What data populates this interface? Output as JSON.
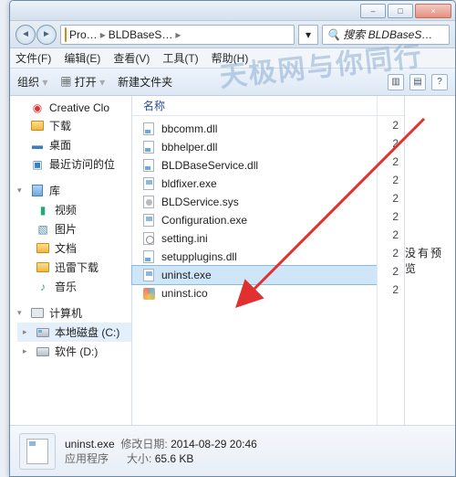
{
  "window": {
    "minimize": "–",
    "maximize": "□",
    "close": "×"
  },
  "address": {
    "back": "◄",
    "fwd": "►",
    "seg1": "Pro…",
    "seg2": "BLDBaseS…",
    "refresh": "↻",
    "search_placeholder": "搜索 BLDBaseS…"
  },
  "menu": {
    "file": "文件(F)",
    "edit": "编辑(E)",
    "view": "查看(V)",
    "tools": "工具(T)",
    "help": "帮助(H)"
  },
  "toolbar": {
    "organize": "组织",
    "open": "打开",
    "newfolder": "新建文件夹",
    "view_ic": "▥",
    "preview_ic": "▤",
    "help_ic": "?"
  },
  "nav": {
    "cc": "Creative Clo",
    "downloads": "下载",
    "desktop": "桌面",
    "recent": "最近访问的位",
    "lib": "库",
    "videos": "视频",
    "pictures": "图片",
    "docs": "文档",
    "xldl": "迅雷下载",
    "music": "音乐",
    "computer": "计算机",
    "drive_c": "本地磁盘 (C:)",
    "drive_d": "软件 (D:)"
  },
  "list": {
    "header_name": "名称",
    "files": [
      {
        "name": "bbcomm.dll",
        "icon": "dll",
        "d": "2"
      },
      {
        "name": "bbhelper.dll",
        "icon": "dll",
        "d": "2"
      },
      {
        "name": "BLDBaseService.dll",
        "icon": "dll",
        "d": "2"
      },
      {
        "name": "bldfixer.exe",
        "icon": "exe",
        "d": "2"
      },
      {
        "name": "BLDService.sys",
        "icon": "sys",
        "d": "2"
      },
      {
        "name": "Configuration.exe",
        "icon": "exe",
        "d": "2"
      },
      {
        "name": "setting.ini",
        "icon": "ini",
        "d": "2"
      },
      {
        "name": "setupplugins.dll",
        "icon": "dll",
        "d": "2"
      },
      {
        "name": "uninst.exe",
        "icon": "exe",
        "d": "2",
        "sel": true
      },
      {
        "name": "uninst.ico",
        "icon": "ico",
        "d": "2"
      }
    ]
  },
  "preview": {
    "text": "没有预览"
  },
  "status": {
    "filename": "uninst.exe",
    "type": "应用程序",
    "mod_label": "修改日期:",
    "mod_value": "2014-08-29 20:46",
    "size_label": "大小:",
    "size_value": "65.6 KB"
  },
  "watermark": "天极网与你同行"
}
